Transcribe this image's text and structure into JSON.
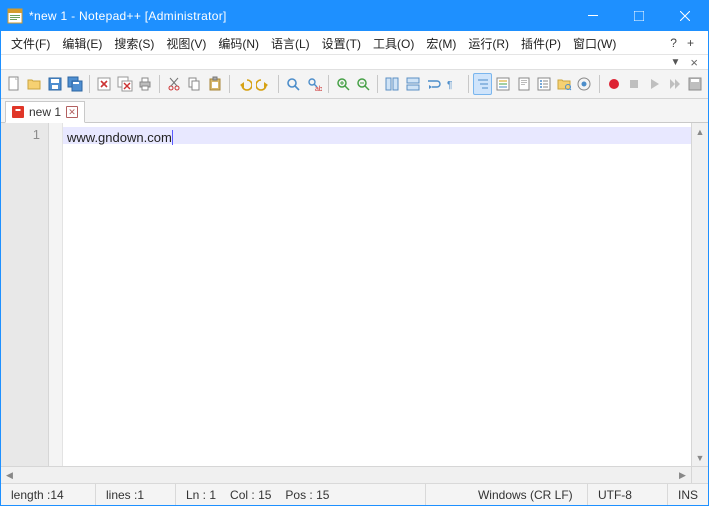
{
  "title": "*new 1 - Notepad++ [Administrator]",
  "menu": {
    "file": "文件(F)",
    "edit": "编辑(E)",
    "search": "搜索(S)",
    "view": "视图(V)",
    "encoding": "编码(N)",
    "language": "语言(L)",
    "settings": "设置(T)",
    "tools": "工具(O)",
    "macro": "宏(M)",
    "run": "运行(R)",
    "plugins": "插件(P)",
    "window": "窗口(W)",
    "help": "?",
    "plus": "+"
  },
  "secondary": {
    "dropdown": "▼",
    "close": "×"
  },
  "tab": {
    "name": "new 1"
  },
  "editor": {
    "line1_num": "1",
    "line1_text": "www.gndown.com"
  },
  "status": {
    "length_label": "length : ",
    "length_val": "14",
    "lines_label": "lines : ",
    "lines_val": "1",
    "ln_label": "Ln : ",
    "ln_val": "1",
    "col_label": "Col : ",
    "col_val": "15",
    "pos_label": "Pos : ",
    "pos_val": "15",
    "eol": "Windows (CR LF)",
    "enc": "UTF-8",
    "ins": "INS"
  },
  "icons": {
    "new": "new",
    "open": "open",
    "save": "save",
    "saveall": "save-all",
    "close": "close",
    "closeall": "close-all",
    "print": "print",
    "cut": "cut",
    "copy": "copy",
    "paste": "paste",
    "undo": "undo",
    "redo": "redo",
    "find": "find",
    "replace": "replace",
    "zoomin": "zoom-in",
    "zoomout": "zoom-out",
    "sync": "sync",
    "wrap": "word-wrap",
    "allchars": "all-chars",
    "indent": "indent-guide",
    "lang": "lang",
    "monitor": "monitor",
    "rec": "macro-record",
    "play": "macro-play",
    "playmulti": "macro-play-multi",
    "savem": "macro-save"
  }
}
